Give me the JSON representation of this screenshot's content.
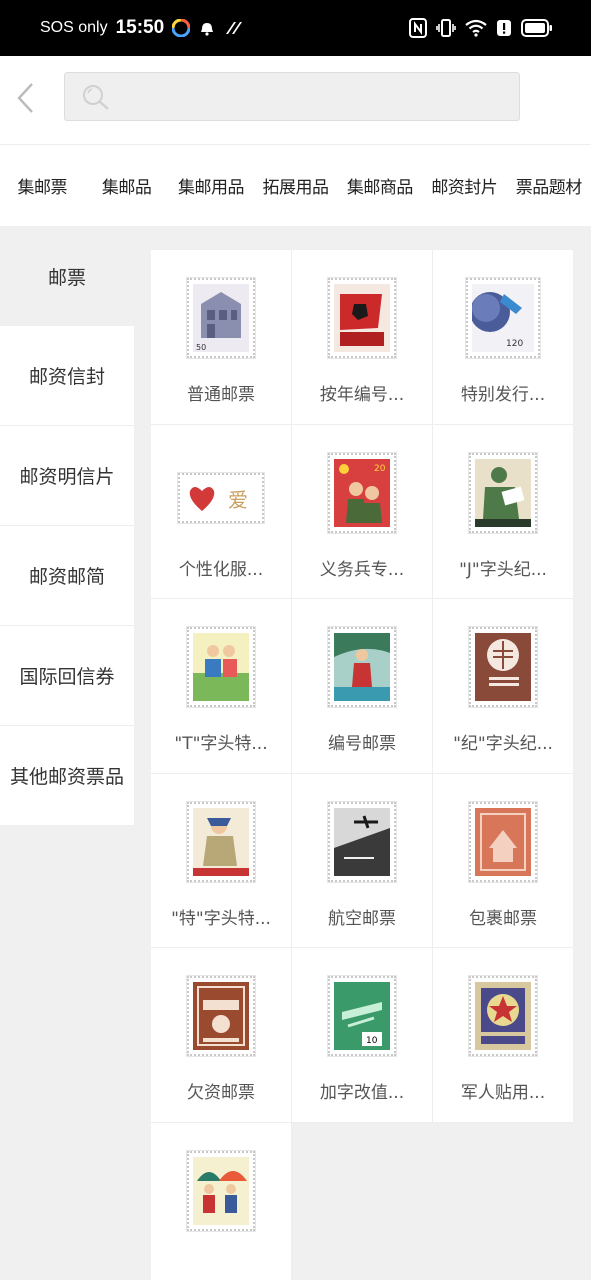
{
  "status_bar": {
    "carrier": "SOS only",
    "time": "15:50"
  },
  "search": {
    "placeholder": ""
  },
  "categories": [
    "集邮票",
    "集邮品",
    "集邮用品",
    "拓展用品",
    "集邮商品",
    "邮资封片",
    "票品题材"
  ],
  "sidebar": {
    "items": [
      "邮票",
      "邮资信封",
      "邮资明信片",
      "邮资邮简",
      "国际回信券",
      "其他邮资票品"
    ],
    "active_index": 0
  },
  "products": [
    {
      "label": "普通邮票",
      "icon": "building-stamp-icon",
      "color": "#8a8fb0"
    },
    {
      "label": "按年编号...",
      "icon": "flag-stamp-icon",
      "color": "#cc2a2a"
    },
    {
      "label": "特别发行...",
      "icon": "planet-stamp-icon",
      "color": "#4a5d9a"
    },
    {
      "label": "个性化服...",
      "icon": "heart-stamp-icon",
      "color": "#d23a3a"
    },
    {
      "label": "义务兵专...",
      "icon": "soldiers-stamp-icon",
      "color": "#c83434"
    },
    {
      "label": "\"J\"字头纪...",
      "icon": "reader-stamp-icon",
      "color": "#4e7a4a"
    },
    {
      "label": "\"T\"字头特...",
      "icon": "children-stamp-icon",
      "color": "#6aa84f"
    },
    {
      "label": "编号邮票",
      "icon": "worker-stamp-icon",
      "color": "#3b7a5a"
    },
    {
      "label": "\"纪\"字头纪...",
      "icon": "emblem-stamp-icon",
      "color": "#8a4a3a"
    },
    {
      "label": "\"特\"字头特...",
      "icon": "girl-stamp-icon",
      "color": "#b8a878"
    },
    {
      "label": "航空邮票",
      "icon": "airplane-stamp-icon",
      "color": "#3a3a3a"
    },
    {
      "label": "包裹邮票",
      "icon": "parcel-stamp-icon",
      "color": "#d8765a"
    },
    {
      "label": "欠资邮票",
      "icon": "postage-due-stamp-icon",
      "color": "#9a4a2e"
    },
    {
      "label": "加字改值...",
      "icon": "surcharge-stamp-icon",
      "color": "#3a9a6a"
    },
    {
      "label": "军人贴用...",
      "icon": "military-star-stamp-icon",
      "color": "#4a4a8a"
    },
    {
      "label": "",
      "icon": "umbrella-children-stamp-icon",
      "color": "#2a7a6a"
    }
  ]
}
